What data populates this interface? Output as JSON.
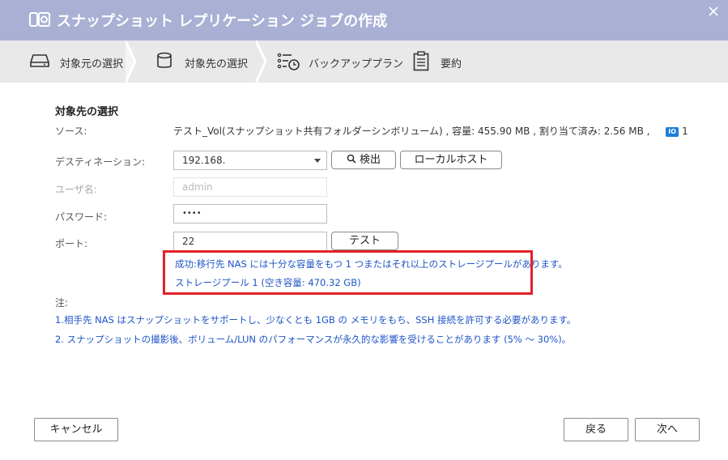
{
  "window": {
    "title": "スナップショット レプリケーション ジョブの作成"
  },
  "steps": [
    {
      "label": "対象元の選択",
      "icon": "drive-icon"
    },
    {
      "label": "対象先の選択",
      "icon": "database-icon"
    },
    {
      "label": "バックアッププラン",
      "icon": "schedule-list-icon"
    },
    {
      "label": "要約",
      "icon": "clipboard-icon"
    }
  ],
  "section": {
    "title": "対象先の選択"
  },
  "source": {
    "label": "ソース:",
    "value": "テスト_Vol(スナップショット共有フォルダーシンボリューム) , 容量: 455.90 MB , 割り当て済み: 2.56 MB ,",
    "snapshot_badge": "IO",
    "snapshot_count": "1"
  },
  "destination": {
    "label": "デスティネーション:",
    "value": "192.168.",
    "detect_label": "検出",
    "localhost_label": "ローカルホスト"
  },
  "username": {
    "label": "ユーザ名:",
    "placeholder": "admin"
  },
  "password": {
    "label": "パスワード:",
    "value": "••••"
  },
  "port": {
    "label": "ポート:",
    "value": "22",
    "test_label": "テスト"
  },
  "result": {
    "line1": "成功:移行先 NAS には十分な容量をもつ 1 つまたはそれ以上のストレージプールがあります。",
    "line2": "ストレージプール 1 (空き容量: 470.32 GB)"
  },
  "notes": {
    "heading": "注:",
    "items": [
      "1.相手先 NAS はスナップショットをサポートし、少なくとも 1GB の メモリをもち、SSH 接続を許可する必要があります。",
      "2. スナップショットの撮影後、ボリューム/LUN のパフォーマンスが永久的な影響を受けることがあります (5% ～ 30%)。"
    ]
  },
  "footer": {
    "cancel": "キャンセル",
    "back": "戻る",
    "next": "次へ"
  },
  "colors": {
    "titlebar": "#a9b0d4",
    "stepbar": "#e9e9e9",
    "accent_text": "#1f55c7",
    "highlight_border": "#e3202a"
  }
}
